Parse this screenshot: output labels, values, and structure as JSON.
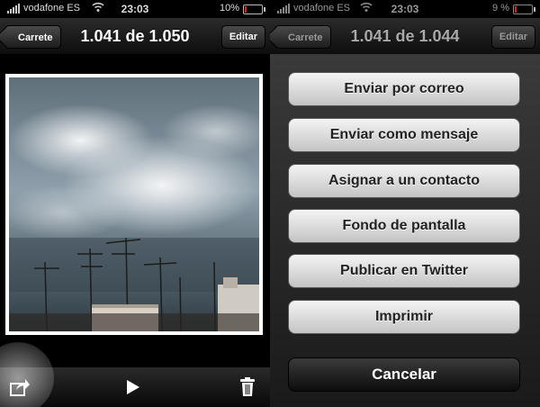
{
  "left": {
    "status": {
      "carrier": "vodafone ES",
      "time": "23:03",
      "battery": "10%",
      "battery_level": 0.1
    },
    "nav": {
      "back_label": "Carrete",
      "title": "1.041 de 1.050",
      "edit_label": "Editar"
    },
    "toolbar": {
      "share_icon": "share-icon",
      "play_icon": "play-icon",
      "trash_icon": "trash-icon"
    }
  },
  "right": {
    "status": {
      "carrier": "vodafone ES",
      "time": "23:03",
      "battery": "9 %",
      "battery_level": 0.09
    },
    "nav": {
      "back_label": "Carrete",
      "title": "1.041 de 1.044",
      "edit_label": "Editar"
    },
    "actions": [
      {
        "label": "Enviar por correo"
      },
      {
        "label": "Enviar como mensaje"
      },
      {
        "label": "Asignar a un contacto"
      },
      {
        "label": "Fondo de pantalla"
      },
      {
        "label": "Publicar en Twitter"
      },
      {
        "label": "Imprimir"
      }
    ],
    "cancel_label": "Cancelar"
  },
  "colors": {
    "battery_low": "#dd2222",
    "sheet_button": "#e0e0e0",
    "cancel_button": "#1a1a1a"
  }
}
